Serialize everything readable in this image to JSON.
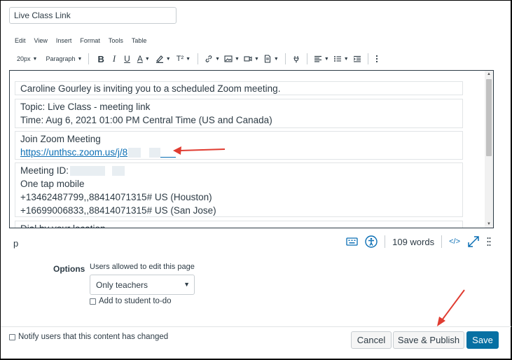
{
  "page_title_value": "Live Class Link",
  "menubar": [
    "Edit",
    "View",
    "Insert",
    "Format",
    "Tools",
    "Table"
  ],
  "toolbar": {
    "font_size": "20px",
    "block_format": "Paragraph",
    "bold": "B",
    "italic": "I",
    "underline": "U",
    "text_color": "A",
    "superscript": "T²"
  },
  "editor": {
    "intro": "Caroline Gourley is inviting you to a scheduled Zoom meeting.",
    "topic": "Topic: Live Class - meeting link",
    "time": "Time: Aug 6, 2021 01:00 PM Central Time (US and Canada)",
    "join_heading": "Join Zoom Meeting",
    "join_link": "https://unthsc.zoom.us/j/8",
    "meeting_id_label": "Meeting ID:",
    "one_tap": "One tap mobile",
    "tap_houston": "+13462487799,,88414071315# US (Houston)",
    "tap_sanjose": "+16699006833,,88414071315# US (San Jose)",
    "cut_off_line": "Dial by your location"
  },
  "statusbar": {
    "element_path": "p",
    "word_count": "109 words",
    "html_toggle": "</>"
  },
  "options": {
    "label": "Options",
    "edit_label": "Users allowed to edit this page",
    "edit_selected": "Only teachers",
    "todo_label": "Add to student to-do"
  },
  "footer": {
    "notify_label": "Notify users that this content has changed",
    "cancel": "Cancel",
    "save_publish": "Save & Publish",
    "save": "Save"
  },
  "colors": {
    "accent": "#0770a3",
    "link": "#0a6eb4",
    "annotation_arrow": "#e03c31"
  }
}
